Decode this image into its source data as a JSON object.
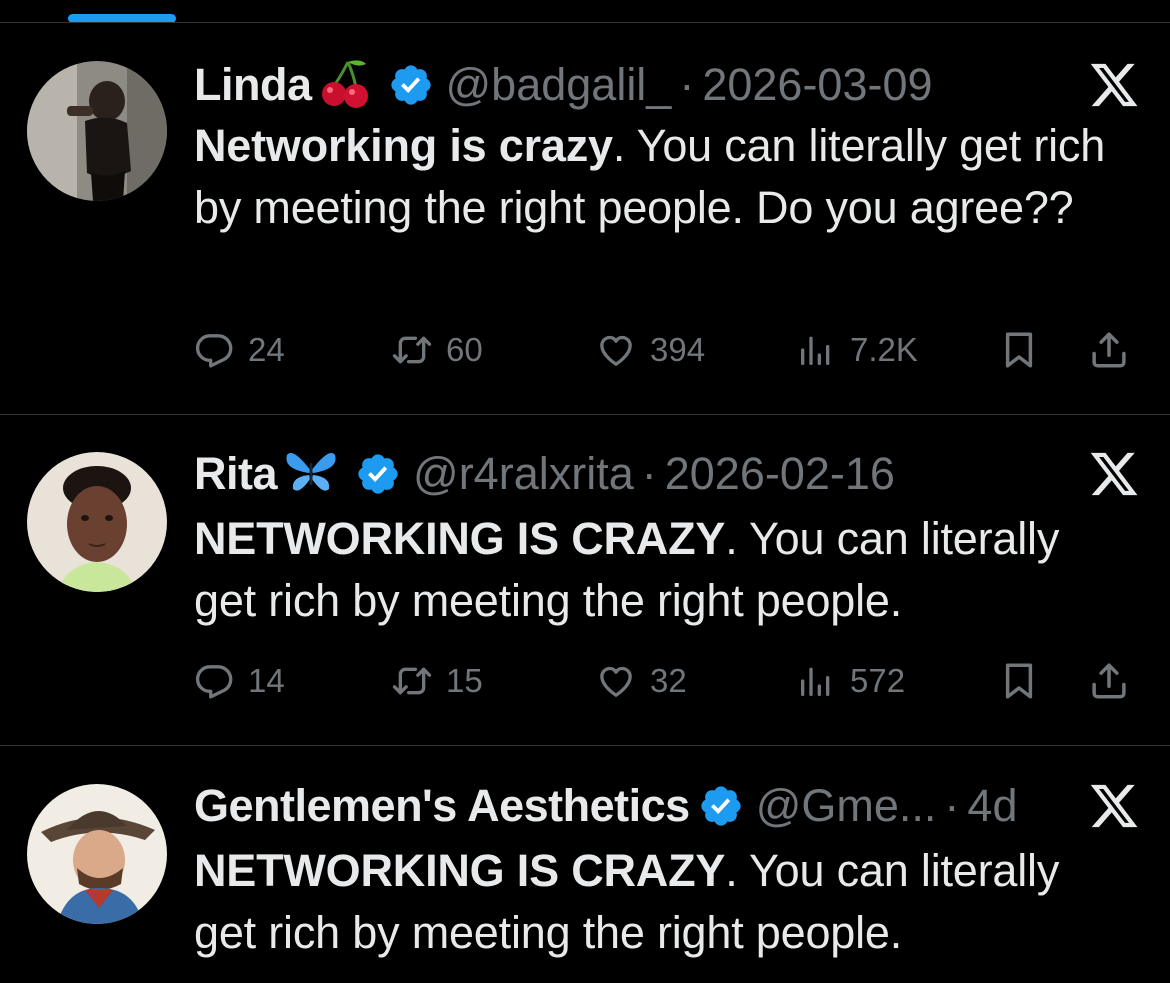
{
  "colors": {
    "accent": "#1d9bf0",
    "background": "#000000",
    "muted": "#71767b",
    "text": "#e7e9ea"
  },
  "tweets": [
    {
      "name": "Linda",
      "name_emoji": "cherry-icon",
      "handle": "@badgalil_",
      "dot": "·",
      "time": "2026-03-09",
      "bold": "Networking is crazy",
      "rest": ". You can literally get rich by meeting the right people. Do you agree??",
      "replies": "24",
      "reposts": "60",
      "likes": "394",
      "views": "7.2K"
    },
    {
      "name": "Rita",
      "name_emoji": "butterfly-icon",
      "handle": "@r4ralxrita",
      "dot": "·",
      "time": "2026-02-16",
      "bold": "NETWORKING IS CRAZY",
      "rest": ". You can literally get rich by meeting the right people.",
      "replies": "14",
      "reposts": "15",
      "likes": "32",
      "views": "572"
    },
    {
      "name": "Gentlemen's Aesthetics",
      "handle": "@Gme...",
      "dot": "·",
      "time": "4d",
      "bold": "NETWORKING IS CRAZY",
      "rest": ". You can literally get rich by meeting the right people."
    }
  ]
}
